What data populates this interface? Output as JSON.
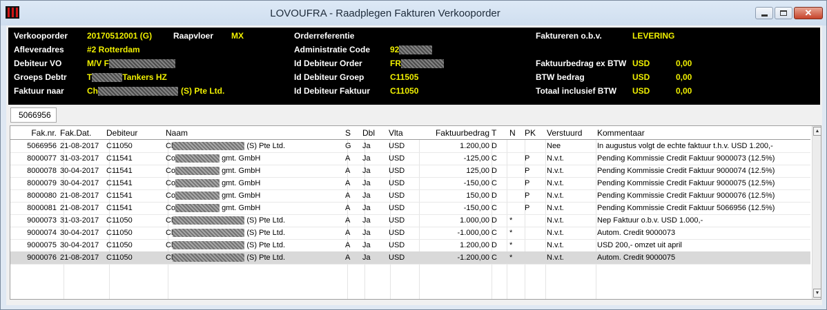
{
  "window": {
    "title": "LOVOUFRA - Raadplegen Fakturen Verkooporder",
    "close_glyph": "✕"
  },
  "header": {
    "verkooporder_label": "Verkooporder",
    "verkooporder_value": "20170512001 (G)",
    "raapvloer_label": "Raapvloer",
    "raapvloer_value": "MX",
    "afleveradres_label": "Afleveradres",
    "afleveradres_value": "#2 Rotterdam",
    "debiteur_vo_label": "Debiteur VO",
    "debiteur_vo_value": "M/V F",
    "groeps_debtr_label": "Groeps Debtr",
    "groeps_debtr_prefix": "T",
    "groeps_debtr_suffix": "Tankers HZ",
    "faktuur_naar_label": "Faktuur naar",
    "faktuur_naar_prefix": "Ch",
    "faktuur_naar_suffix": "(S) Pte Ltd.",
    "orderreferentie_label": "Orderreferentie",
    "administratie_label": "Administratie Code",
    "administratie_value": "92",
    "id_deb_order_label": "Id Debiteur Order",
    "id_deb_order_value": "FR",
    "id_deb_groep_label": "Id Debiteur Groep",
    "id_deb_groep_value": "C11505",
    "id_deb_faktuur_label": "Id Debiteur Faktuur",
    "id_deb_faktuur_value": "C11050",
    "factureren_label": "Faktureren o.b.v.",
    "factureren_value": "LEVERING",
    "faktuurbedrag_label": "Faktuurbedrag ex BTW",
    "faktuurbedrag_cur": "USD",
    "faktuurbedrag_value": "0,00",
    "btw_label": "BTW bedrag",
    "btw_cur": "USD",
    "btw_value": "0,00",
    "totaal_label": "Totaal inclusief BTW",
    "totaal_cur": "USD",
    "totaal_value": "0,00"
  },
  "filter": {
    "faktuur_nr": "5066956"
  },
  "table": {
    "columns": [
      "Fak.nr.",
      "Fak.Dat.",
      "Debiteur",
      "Naam",
      "S",
      "Dbl",
      "Vlta",
      "Faktuurbedrag",
      "T",
      "N",
      "PK",
      "Verstuurd",
      "Kommentaar"
    ],
    "rows": [
      {
        "fak_nr": "5066956",
        "fak_dat": "21-08-2017",
        "debiteur": "C11050",
        "naam_prefix": "Cl",
        "naam_suffix": "(S) Pte Ltd.",
        "s": "G",
        "dbl": "Ja",
        "vlta": "USD",
        "bedrag": "1.200,00",
        "t": "D",
        "n": "",
        "pk": "",
        "verstuurd": "Nee",
        "kommentaar": "In augustus volgt de echte faktuur t.h.v. USD 1.200,-"
      },
      {
        "fak_nr": "8000077",
        "fak_dat": "31-03-2017",
        "debiteur": "C11541",
        "naam_prefix": "Co",
        "naam_suffix": "gmt. GmbH",
        "s": "A",
        "dbl": "Ja",
        "vlta": "USD",
        "bedrag": "-125,00",
        "t": "C",
        "n": "",
        "pk": "P",
        "verstuurd": "N.v.t.",
        "kommentaar": "Pending Kommissie Credit Faktuur 9000073 (12.5%)"
      },
      {
        "fak_nr": "8000078",
        "fak_dat": "30-04-2017",
        "debiteur": "C11541",
        "naam_prefix": "Co",
        "naam_suffix": "gmt. GmbH",
        "s": "A",
        "dbl": "Ja",
        "vlta": "USD",
        "bedrag": "125,00",
        "t": "D",
        "n": "",
        "pk": "P",
        "verstuurd": "N.v.t.",
        "kommentaar": "Pending Kommissie Credit Faktuur 9000074 (12.5%)"
      },
      {
        "fak_nr": "8000079",
        "fak_dat": "30-04-2017",
        "debiteur": "C11541",
        "naam_prefix": "Co",
        "naam_suffix": "gmt. GmbH",
        "s": "A",
        "dbl": "Ja",
        "vlta": "USD",
        "bedrag": "-150,00",
        "t": "C",
        "n": "",
        "pk": "P",
        "verstuurd": "N.v.t.",
        "kommentaar": "Pending Kommissie Credit Faktuur 9000075 (12.5%)"
      },
      {
        "fak_nr": "8000080",
        "fak_dat": "21-08-2017",
        "debiteur": "C11541",
        "naam_prefix": "Co",
        "naam_suffix": "gmt. GmbH",
        "s": "A",
        "dbl": "Ja",
        "vlta": "USD",
        "bedrag": "150,00",
        "t": "D",
        "n": "",
        "pk": "P",
        "verstuurd": "N.v.t.",
        "kommentaar": "Pending Kommissie Credit Faktuur 9000076 (12.5%)"
      },
      {
        "fak_nr": "8000081",
        "fak_dat": "21-08-2017",
        "debiteur": "C11541",
        "naam_prefix": "Co",
        "naam_suffix": "gmt. GmbH",
        "s": "A",
        "dbl": "Ja",
        "vlta": "USD",
        "bedrag": "-150,00",
        "t": "C",
        "n": "",
        "pk": "P",
        "verstuurd": "N.v.t.",
        "kommentaar": "Pending Kommissie Credit Faktuur 5066956 (12.5%)"
      },
      {
        "fak_nr": "9000073",
        "fak_dat": "31-03-2017",
        "debiteur": "C11050",
        "naam_prefix": "Cl",
        "naam_suffix": "(S) Pte Ltd.",
        "s": "A",
        "dbl": "Ja",
        "vlta": "USD",
        "bedrag": "1.000,00",
        "t": "D",
        "n": "*",
        "pk": "",
        "verstuurd": "N.v.t.",
        "kommentaar": "Nep Faktuur o.b.v. USD 1.000,-"
      },
      {
        "fak_nr": "9000074",
        "fak_dat": "30-04-2017",
        "debiteur": "C11050",
        "naam_prefix": "Cl",
        "naam_suffix": "(S) Pte Ltd.",
        "s": "A",
        "dbl": "Ja",
        "vlta": "USD",
        "bedrag": "-1.000,00",
        "t": "C",
        "n": "*",
        "pk": "",
        "verstuurd": "N.v.t.",
        "kommentaar": "Autom. Credit 9000073"
      },
      {
        "fak_nr": "9000075",
        "fak_dat": "30-04-2017",
        "debiteur": "C11050",
        "naam_prefix": "Cl",
        "naam_suffix": "(S) Pte Ltd.",
        "s": "A",
        "dbl": "Ja",
        "vlta": "USD",
        "bedrag": "1.200,00",
        "t": "D",
        "n": "*",
        "pk": "",
        "verstuurd": "N.v.t.",
        "kommentaar": "USD 200,- omzet uit april"
      },
      {
        "fak_nr": "9000076",
        "fak_dat": "21-08-2017",
        "debiteur": "C11050",
        "naam_prefix": "Cl",
        "naam_suffix": "(S) Pte Ltd.",
        "s": "A",
        "dbl": "Ja",
        "vlta": "USD",
        "bedrag": "-1.200,00",
        "t": "C",
        "n": "*",
        "pk": "",
        "verstuurd": "N.v.t.",
        "kommentaar": "Autom. Credit 9000075",
        "selected": true
      }
    ]
  },
  "scrollbar": {
    "up_glyph": "▲",
    "down_glyph": "▼"
  }
}
